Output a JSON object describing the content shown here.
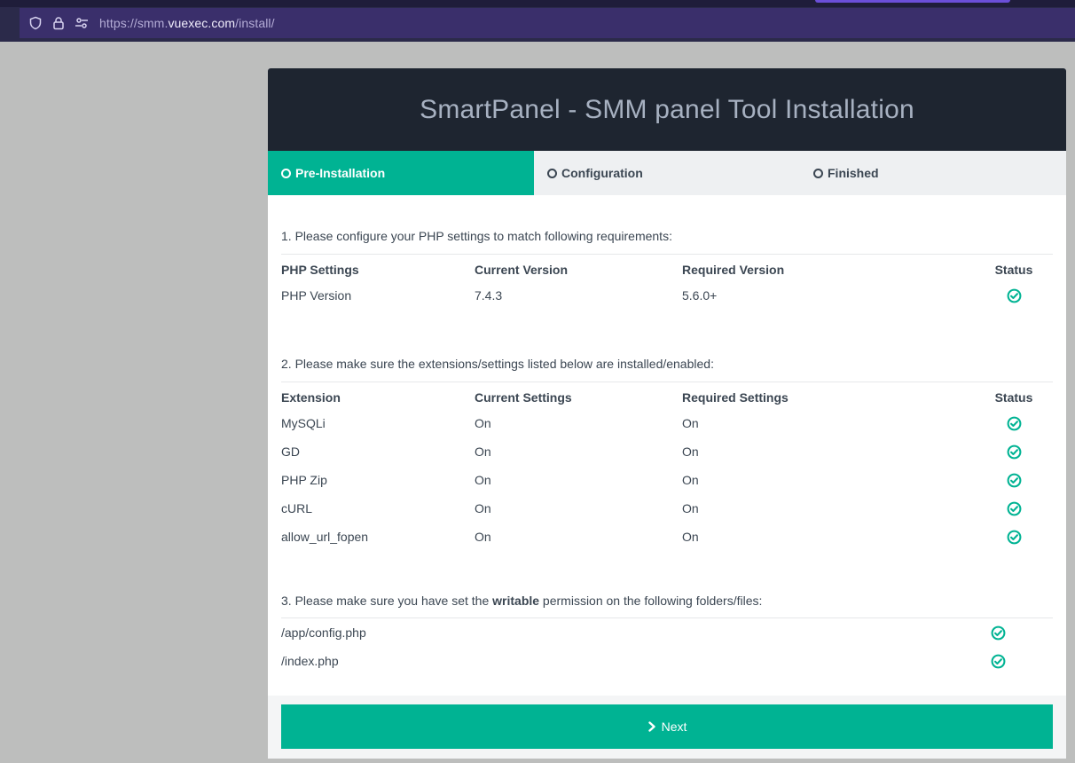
{
  "browser": {
    "url_scheme": "https://smm.",
    "url_host": "vuexec.com",
    "url_path": "/install/",
    "icons": [
      "shield-icon",
      "lock-icon",
      "permissions-icon"
    ]
  },
  "installer": {
    "title": "SmartPanel - SMM panel Tool Installation",
    "steps": [
      {
        "label": "Pre-Installation",
        "active": true
      },
      {
        "label": "Configuration",
        "active": false
      },
      {
        "label": "Finished",
        "active": false
      }
    ],
    "php_section": {
      "title": "1. Please configure your PHP settings to match following requirements:",
      "headers": [
        "PHP Settings",
        "Current Version",
        "Required Version",
        "Status"
      ],
      "rows": [
        {
          "name": "PHP Version",
          "current": "7.4.3",
          "required": "5.6.0+",
          "status": "check-icon"
        }
      ]
    },
    "ext_section": {
      "title": "2. Please make sure the extensions/settings listed below are installed/enabled:",
      "headers": [
        "Extension",
        "Current Settings",
        "Required Settings",
        "Status"
      ],
      "rows": [
        {
          "name": "MySQLi",
          "current": "On",
          "required": "On",
          "status": "check-icon"
        },
        {
          "name": "GD",
          "current": "On",
          "required": "On",
          "status": "check-icon"
        },
        {
          "name": "PHP Zip",
          "current": "On",
          "required": "On",
          "status": "check-icon"
        },
        {
          "name": "cURL",
          "current": "On",
          "required": "On",
          "status": "check-icon"
        },
        {
          "name": "allow_url_fopen",
          "current": "On",
          "required": "On",
          "status": "check-icon"
        }
      ]
    },
    "files_section": {
      "title_pre": "3. Please make sure you have set the ",
      "title_bold": "writable",
      "title_post": " permission on the following folders/files:",
      "rows": [
        {
          "path": "/app/config.php",
          "status": "check-icon"
        },
        {
          "path": "/index.php",
          "status": "check-icon"
        }
      ]
    },
    "next_label": "Next"
  },
  "colors": {
    "accent": "#00b393",
    "header_bg": "#1e2530",
    "title_text": "#a7b1c1",
    "page_bg": "#bdbebd",
    "browser_bg": "#2b2a4a"
  }
}
